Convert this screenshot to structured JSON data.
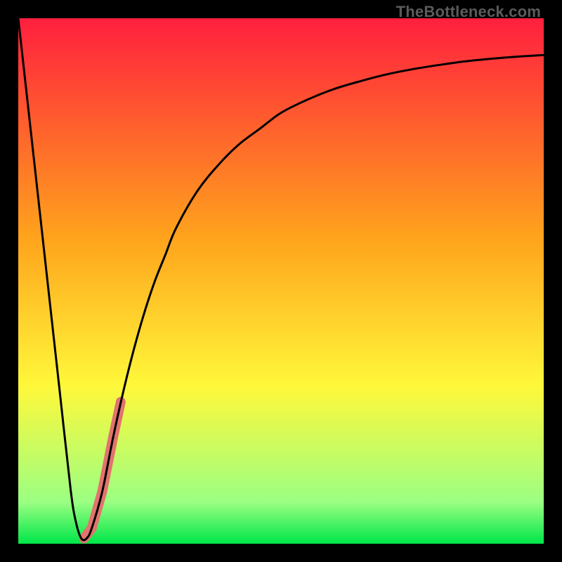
{
  "watermark": "TheBottleneck.com",
  "gradient": {
    "red": "#ff1f3e",
    "orange": "#ffa41c",
    "yellow": "#fff83a",
    "greenPale": "#9cff82",
    "green": "#00e64a"
  },
  "chart_data": {
    "type": "line",
    "title": "",
    "xlabel": "",
    "ylabel": "",
    "xlim": [
      0,
      100
    ],
    "ylim": [
      0,
      100
    ],
    "series": [
      {
        "name": "bottleneck-curve",
        "color": "#000000",
        "stroke_width": 3,
        "x": [
          0,
          2,
          4,
          6,
          8,
          10,
          11,
          12,
          13,
          14,
          16,
          18,
          20,
          22,
          24,
          26,
          28,
          30,
          34,
          38,
          42,
          46,
          50,
          55,
          60,
          65,
          70,
          75,
          80,
          85,
          90,
          95,
          100
        ],
        "y": [
          100,
          82,
          64,
          46,
          28,
          10,
          4,
          1,
          1,
          3,
          10,
          20,
          29,
          37,
          44,
          50,
          55,
          60,
          67,
          72,
          76,
          79,
          82,
          84.5,
          86.5,
          88,
          89.3,
          90.3,
          91.1,
          91.8,
          92.3,
          92.7,
          93
        ]
      },
      {
        "name": "highlight-segment",
        "color": "#e2736e",
        "stroke_width": 14,
        "linecap": "round",
        "x": [
          12.5,
          14,
          16,
          18,
          19.5
        ],
        "y": [
          1,
          3,
          10,
          20,
          27
        ]
      }
    ]
  }
}
